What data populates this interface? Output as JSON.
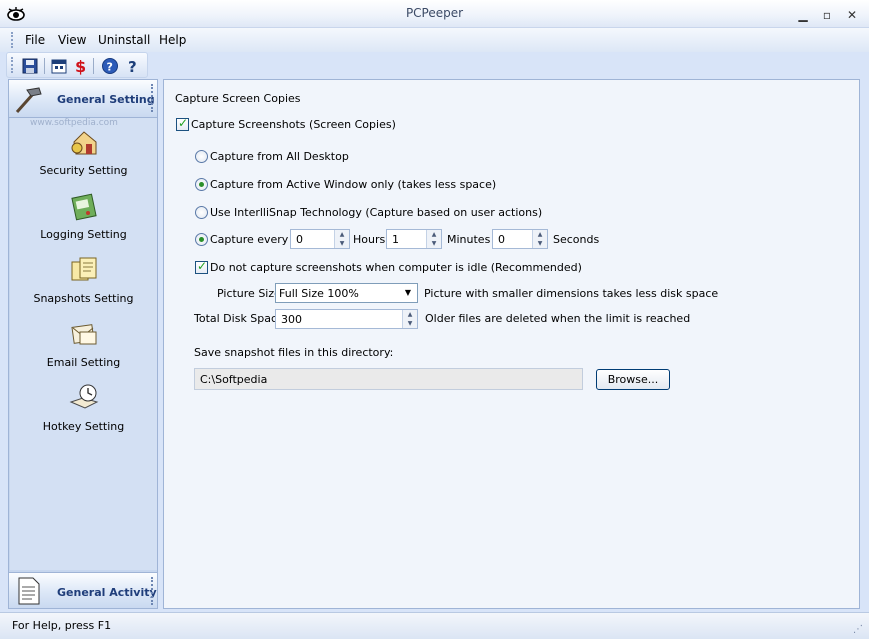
{
  "window": {
    "title": "PCPeeper",
    "minimize_icon": "minimize-icon",
    "maximize_icon": "maximize-icon",
    "close_icon": "close-icon"
  },
  "menu": {
    "items": [
      "File",
      "View",
      "Uninstall",
      "Help"
    ]
  },
  "toolbar": {
    "icons": [
      "save-icon",
      "calendar-icon",
      "dollar-icon",
      "help-circle-icon",
      "question-icon"
    ]
  },
  "sidebar": {
    "top_group": "General Setting",
    "watermark": "www.softpedia.com",
    "items": [
      {
        "label": "Security Setting",
        "icon": "house-lock-icon"
      },
      {
        "label": "Logging Setting",
        "icon": "notepad-icon"
      },
      {
        "label": "Snapshots Setting",
        "icon": "snapshots-icon"
      },
      {
        "label": "Email Setting",
        "icon": "envelope-icon"
      },
      {
        "label": "Hotkey Setting",
        "icon": "clock-book-icon"
      }
    ],
    "bottom_group": "General Activity"
  },
  "settings": {
    "section_title": "Capture Screen Copies",
    "capture_screenshots": "Capture Screenshots (Screen Copies)",
    "opt_all_desktop": "Capture from All Desktop",
    "opt_active_window": "Capture from Active Window only (takes less space)",
    "opt_intellisnap": "Use InterlliSnap Technology (Capture based on user actions)",
    "capture_every_label": "Capture every",
    "hours_value": "0",
    "hours_label": "Hours",
    "minutes_value": "1",
    "minutes_label": "Minutes",
    "seconds_value": "0",
    "seconds_label": "Seconds",
    "idle_check": "Do not capture screenshots when computer is idle (Recommended)",
    "picture_size_label": "Picture Size",
    "picture_size_value": "Full Size 100%",
    "picture_size_note": "Picture with smaller dimensions takes less disk space",
    "disk_space_label": "Total Disk Space",
    "disk_space_value": "300",
    "disk_space_note": "Older files are deleted when the limit is reached",
    "dir_label": "Save snapshot files in this directory:",
    "dir_value": "C:\\Softpedia",
    "browse_label": "Browse..."
  },
  "status": {
    "text": "For Help, press F1"
  }
}
